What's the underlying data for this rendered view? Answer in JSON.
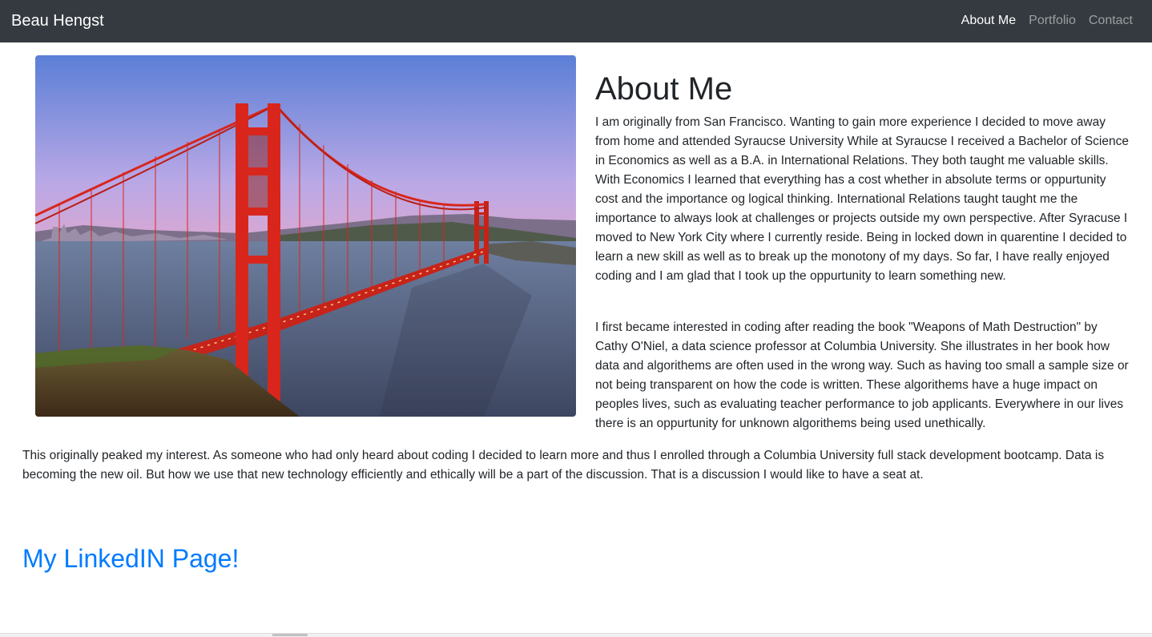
{
  "nav": {
    "brand": "Beau Hengst",
    "links": [
      {
        "label": "About Me",
        "active": true
      },
      {
        "label": "Portfolio",
        "active": false
      },
      {
        "label": "Contact",
        "active": false
      }
    ]
  },
  "main": {
    "title": "About Me",
    "image": {
      "subject": "golden-gate-bridge-photo"
    },
    "paragraphs": [
      "I am originally from San Francisco. Wanting to gain more experience I decided to move away from home and attended Syraucse University While at Syraucse I received a Bachelor of Science in Economics as well as a B.A. in International Relations. They both taught me valuable skills. With Economics I learned that everything has a cost whether in absolute terms or oppurtunity cost and the importance og logical thinking. International Relations taught taught me the importance to always look at challenges or projects outside my own perspective. After Syracuse I moved to New York City where I currently reside. Being in locked down in quarentine I decided to learn a new skill as well as to break up the monotony of my days. So far, I have really enjoyed coding and I am glad that I took up the oppurtunity to learn something new.",
      "I first became interested in coding after reading the book \"Weapons of Math Destruction\" by Cathy O'Niel, a data science professor at Columbia University. She illustrates in her book how data and algorithems are often used in the wrong way. Such as having too small a sample size or not being transparent on how the code is written. These algorithems have a huge impact on peoples lives, such as evaluating teacher performance to job applicants. Everywhere in our lives there is an oppurtunity for unknown algorithems being used unethically.",
      "This originally peaked my interest. As someone who had only heard about coding I decided to learn more and thus I enrolled through a Columbia University full stack development bootcamp. Data is becoming the new oil. But how we use that new technology efficiently and ethically will be a part of the discussion. That is a discussion I would like to have a seat at."
    ],
    "linkedin_label": "My LinkedIN Page!"
  },
  "colors": {
    "navbar_bg": "#343a40",
    "link_blue": "#007bff",
    "bridge_red": "#d8261c"
  }
}
